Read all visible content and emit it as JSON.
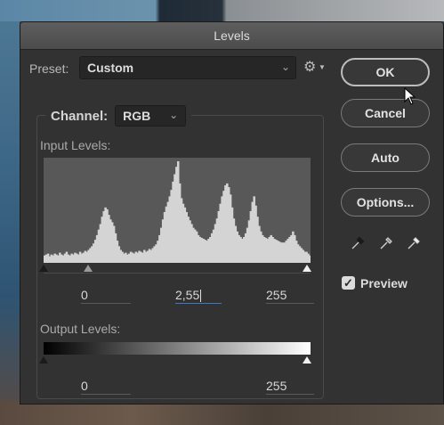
{
  "dialog": {
    "title": "Levels"
  },
  "preset": {
    "label": "Preset:",
    "value": "Custom"
  },
  "channel": {
    "label": "Channel:",
    "value": "RGB"
  },
  "input_levels": {
    "label": "Input Levels:",
    "black": "0",
    "midtone": "2,55",
    "white": "255",
    "histogram_heights": [
      8,
      9,
      10,
      7,
      9,
      8,
      10,
      9,
      8,
      11,
      9,
      8,
      10,
      12,
      9,
      8,
      10,
      9,
      11,
      10,
      9,
      12,
      10,
      11,
      13,
      12,
      14,
      16,
      18,
      21,
      25,
      30,
      36,
      42,
      50,
      56,
      60,
      58,
      52,
      47,
      44,
      40,
      32,
      24,
      18,
      14,
      12,
      10,
      11,
      9,
      10,
      12,
      11,
      10,
      12,
      11,
      13,
      12,
      11,
      14,
      12,
      13,
      15,
      14,
      16,
      18,
      20,
      24,
      30,
      38,
      47,
      55,
      61,
      66,
      72,
      79,
      88,
      96,
      104,
      110,
      86,
      70,
      64,
      60,
      55,
      50,
      46,
      42,
      38,
      36,
      34,
      30,
      28,
      27,
      26,
      25,
      24,
      26,
      28,
      32,
      36,
      42,
      48,
      56,
      64,
      72,
      78,
      84,
      86,
      82,
      74,
      60,
      48,
      40,
      34,
      30,
      28,
      26,
      28,
      32,
      38,
      46,
      56,
      66,
      72,
      62,
      50,
      40,
      34,
      30,
      28,
      27,
      26,
      28,
      30,
      28,
      26,
      25,
      24,
      23,
      22,
      22,
      22,
      24,
      26,
      28,
      30,
      34,
      30,
      24,
      20,
      18,
      16,
      14,
      12,
      12,
      10,
      8
    ]
  },
  "output_levels": {
    "label": "Output Levels:",
    "black": "0",
    "white": "255"
  },
  "buttons": {
    "ok": "OK",
    "cancel": "Cancel",
    "auto": "Auto",
    "options": "Options..."
  },
  "preview": {
    "label": "Preview",
    "checked": true
  },
  "icons": [
    "gear-icon",
    "black-eyedropper-icon",
    "gray-eyedropper-icon",
    "white-eyedropper-icon",
    "checkmark-icon",
    "cursor-icon"
  ]
}
